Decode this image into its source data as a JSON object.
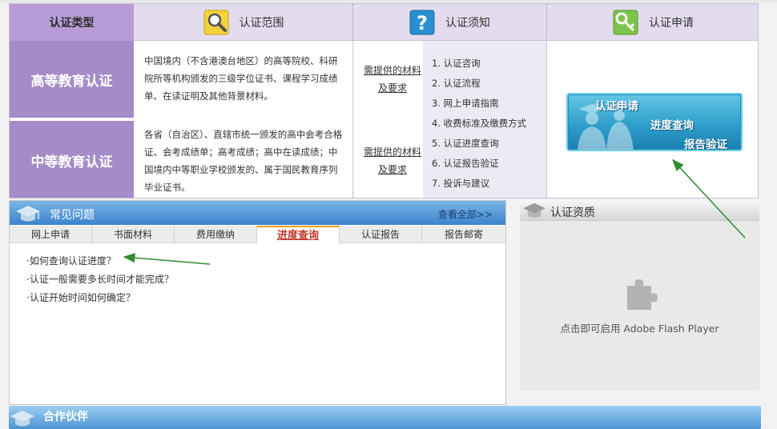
{
  "header": {
    "type_label": "认证类型",
    "scope_label": "认证范围",
    "notice_label": "认证须知",
    "apply_label": "认证申请"
  },
  "rows": [
    {
      "name": "高等教育认证",
      "scope": "中国境内（不含港澳台地区）的高等院校、科研院所等机构颁发的三级学位证书、课程学习成绩单、在读证明及其他背景材料。",
      "materials": "需提供的材料及要求"
    },
    {
      "name": "中等教育认证",
      "scope": "各省（自治区）、直辖市统一颁发的高中会考合格证、会考成绩单；高考成绩；高中在读成绩；中国境内中等职业学校颁发的、属于国民教育序列毕业证书。",
      "materials": "需提供的材料及要求"
    }
  ],
  "notices": [
    "1. 认证咨询",
    "2. 认证流程",
    "3. 网上申请指南",
    "4. 收费标准及缴费方式",
    "5. 认证进度查询",
    "6. 认证报告验证",
    "7. 投诉与建议"
  ],
  "apply_banner": {
    "line1": "认证申请",
    "line2": "进度查询",
    "line3": "报告验证"
  },
  "faq": {
    "title": "常见问题",
    "more": "查看全部>>",
    "tabs": [
      "网上申请",
      "书面材料",
      "费用缴纳",
      "进度查询",
      "认证报告",
      "报告邮寄"
    ],
    "active_tab": 3,
    "items": [
      "·如何查询认证进度？",
      "·认证一般需要多长时间才能完成？",
      "·认证开始时间如何确定？"
    ]
  },
  "qualification": {
    "title": "认证资质",
    "flash_text": "点击即可启用 Adobe Flash Player"
  },
  "partners": {
    "title": "合作伙伴"
  },
  "colors": {
    "accent_purple": "#a58bc7",
    "header_lavender": "#e3dcee",
    "faq_blue": "#3a83cc",
    "active_tab_red": "#c0392b",
    "annotation_green": "#2e8b2e"
  }
}
